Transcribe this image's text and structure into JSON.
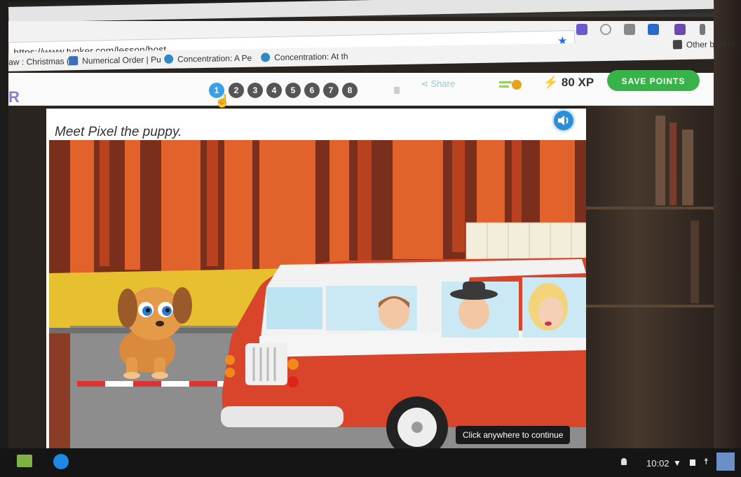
{
  "browser": {
    "url": "https://www.tynker.com/lesson/host",
    "bookmarks": [
      {
        "label": "aw : Christmas ("
      },
      {
        "label": "Numerical Order | Pu"
      },
      {
        "label": "Concentration: A Pe"
      },
      {
        "label": "Concentration: At th"
      }
    ],
    "other_bookmarks": "Other bookm"
  },
  "header": {
    "logo": "R",
    "steps": [
      "1",
      "2",
      "3",
      "4",
      "5",
      "6",
      "7",
      "8"
    ],
    "active_step": "1",
    "share_label": "Share",
    "xp_label": "80 XP",
    "save_label": "SAVE POINTS"
  },
  "lesson": {
    "caption": "Meet Pixel the puppy.",
    "continue_label": "Click anywhere to continue"
  },
  "taskbar": {
    "clock": "10:02"
  },
  "colors": {
    "accent": "#3aa0e6",
    "save_green": "#37b34a",
    "car_red": "#d9452a"
  }
}
